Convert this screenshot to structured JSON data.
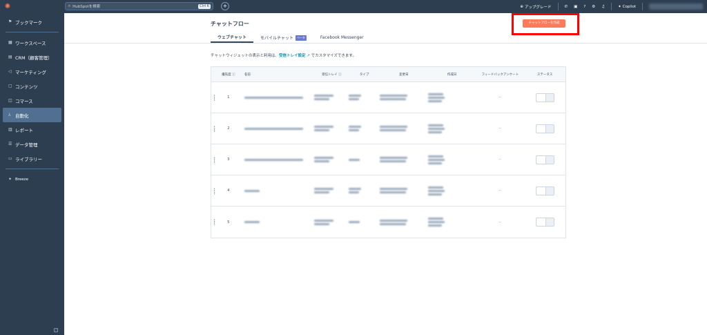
{
  "topbar": {
    "search_placeholder": "HubSpotを検索",
    "shortcut": "Ctrl K",
    "upgrade_label": "アップグレード",
    "copilot_label": "Copilot",
    "notification_count": "1"
  },
  "sidebar": {
    "items": [
      {
        "label": "ブックマーク",
        "icon": "bookmark-icon"
      },
      {
        "label": "ワークスペース",
        "icon": "workspace-icon"
      },
      {
        "label": "CRM（顧客管理）",
        "icon": "crm-icon"
      },
      {
        "label": "マーケティング",
        "icon": "megaphone-icon"
      },
      {
        "label": "コンテンツ",
        "icon": "content-icon"
      },
      {
        "label": "コマース",
        "icon": "commerce-icon"
      },
      {
        "label": "自動化",
        "icon": "automation-icon"
      },
      {
        "label": "レポート",
        "icon": "chart-icon"
      },
      {
        "label": "データ管理",
        "icon": "database-icon"
      },
      {
        "label": "ライブラリー",
        "icon": "folder-icon"
      }
    ],
    "breeze_label": "Breeze"
  },
  "page": {
    "title": "チャットフロー",
    "create_button": "チャットフローを作成",
    "tabs": [
      {
        "label": "ウェブチャット",
        "active": true
      },
      {
        "label": "モバイルチャット",
        "badge": "ベータ"
      },
      {
        "label": "Facebook Messenger"
      }
    ],
    "description_prefix": "チャットウィジェットの表示と利用は、",
    "description_link": "受信トレイ設定",
    "description_suffix": "でカスタマイズできます。"
  },
  "table": {
    "headers": {
      "priority": "優先度",
      "name": "名前",
      "inbox": "受信トレイ",
      "type": "タイプ",
      "updated": "変更日",
      "created": "作成日",
      "feedback": "フィードバックアンケート",
      "status": "ステータス"
    },
    "rows": [
      {
        "priority": "1",
        "feedback": "--"
      },
      {
        "priority": "2",
        "feedback": "--"
      },
      {
        "priority": "3",
        "feedback": "--"
      },
      {
        "priority": "4",
        "feedback": "--"
      },
      {
        "priority": "5",
        "feedback": "--"
      }
    ]
  }
}
